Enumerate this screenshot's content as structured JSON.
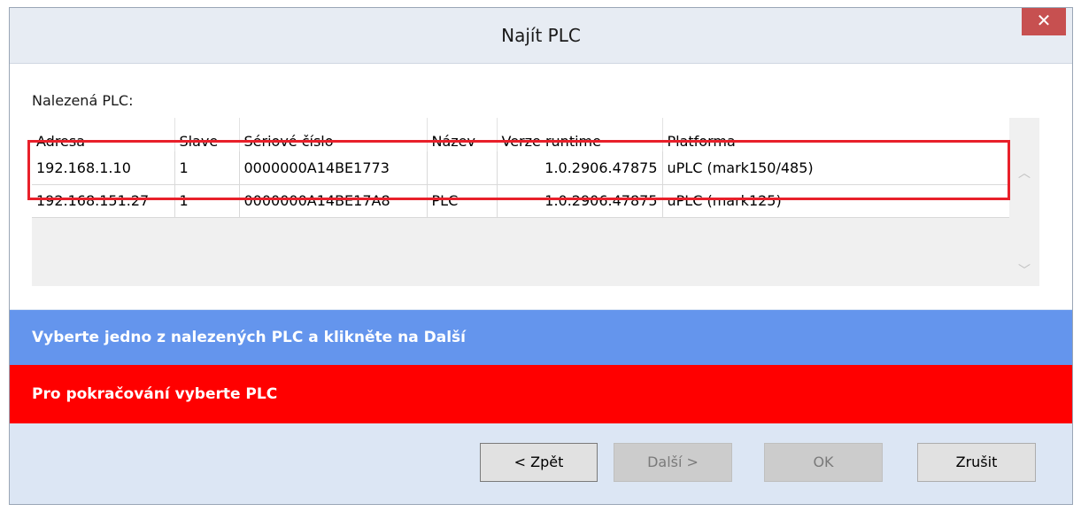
{
  "window": {
    "title": "Najít PLC",
    "close_glyph": "✕"
  },
  "content": {
    "section_label": "Nalezená PLC:",
    "columns": [
      "Adresa",
      "Slave",
      "Sériové číslo",
      "Název",
      "Verze runtime",
      "Platforma"
    ],
    "rows": [
      [
        "192.168.1.10",
        "1",
        "0000000A14BE1773",
        "",
        "1.0.2906.47875",
        "uPLC (mark150/485)"
      ],
      [
        "192.168.151.27",
        "1",
        "0000000A14BE17A8",
        "PLC",
        "1.0.2906.47875",
        "uPLC (mark125)"
      ]
    ],
    "scroll_up_glyph": "︿",
    "scroll_down_glyph": "﹀"
  },
  "info_message": "Vyberte jedno z nalezených PLC a klikněte na Další",
  "error_message": "Pro pokračování vyberte PLC",
  "buttons": {
    "back": "< Zpět",
    "next": "Další >",
    "ok": "OK",
    "cancel": "Zrušit"
  },
  "colors": {
    "info_bar": "#6495ed",
    "error_bar": "#ff0000",
    "highlight": "#e8202a",
    "close_button": "#c75050"
  }
}
